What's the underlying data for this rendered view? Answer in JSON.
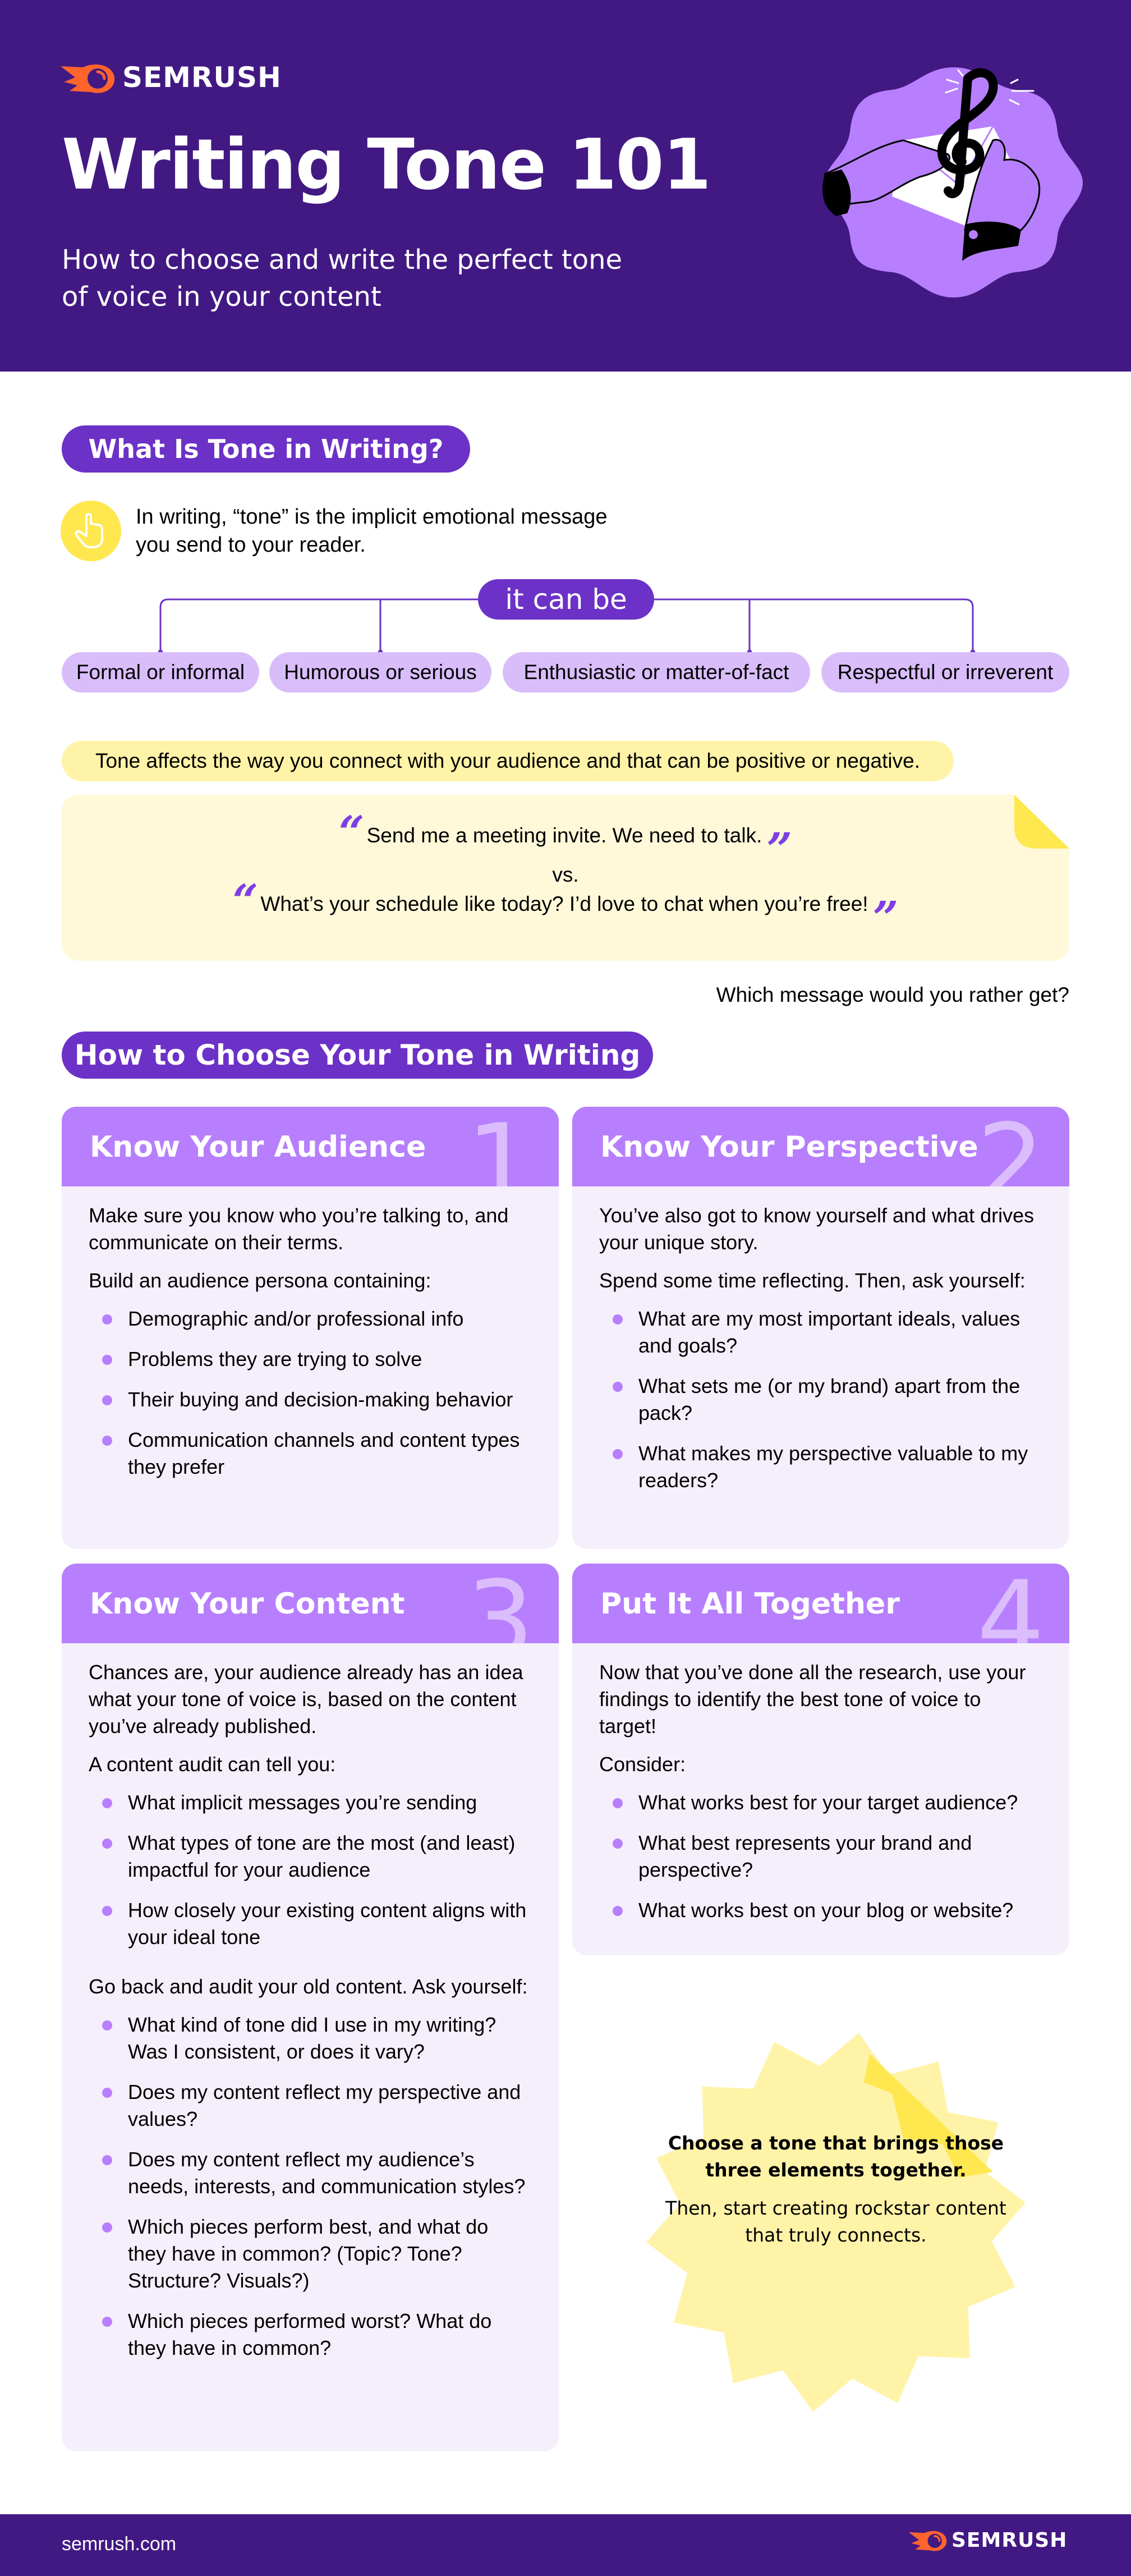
{
  "brand": {
    "name": "SEMRUSH",
    "accent": "#ff642d",
    "header_bg": "#421983",
    "purple": "#6c31c7",
    "lilac": "#b77ffd",
    "yellow": "#ffe74f"
  },
  "header": {
    "title": "Writing Tone 101",
    "subtitle": "How to choose and write the perfect tone of voice in your content",
    "illustration": "treble-clef-envelope-hands-illustration"
  },
  "section_what": {
    "heading": "What Is Tone in Writing?",
    "intro_icon": "pointing-hand-icon",
    "intro": "In writing, “tone” is the implicit emotional message you send to your reader.",
    "connector": "it can be",
    "options": [
      "Formal or informal",
      "Humorous or serious",
      "Enthusiastic or matter-of-fact",
      "Respectful or irreverent"
    ],
    "callout": "Tone affects the way you connect with your audience and that can be positive or negative.",
    "quote_1": "Send me a meeting invite. We need to talk.",
    "versus": "vs.",
    "quote_2": "What’s your schedule like today? I’d love to chat when you’re free!",
    "question": "Which message would you rather get?"
  },
  "section_how": {
    "heading": "How to Choose Your Tone in Writing",
    "cards": [
      {
        "number": "1",
        "title": "Know Your Audience",
        "paragraphs": [
          "Make sure you know who you’re talking to, and communicate on their terms.",
          "Build an audience persona containing:"
        ],
        "bullets": [
          "Demographic and/or professional info",
          "Problems they are trying to solve",
          "Their buying and decision-making behavior",
          "Communication channels and content types they prefer"
        ]
      },
      {
        "number": "2",
        "title": "Know Your Perspective",
        "paragraphs": [
          "You’ve also got to know yourself and what drives your unique story.",
          "Spend some time reflecting. Then, ask yourself:"
        ],
        "bullets": [
          "What are my most important ideals, values and goals?",
          "What sets me (or my brand) apart from the pack?",
          "What makes my perspective valuable to my readers?"
        ]
      },
      {
        "number": "3",
        "title": "Know Your Content",
        "paragraphs": [
          "Chances are, your audience already has an idea what your tone of voice is, based on the content you’ve already published.",
          "A content audit can tell you:"
        ],
        "bullets": [
          "What implicit messages you’re sending",
          "What types of tone are the most (and least) impactful for your audience",
          "How closely your existing content aligns with your ideal tone"
        ],
        "paragraphs_2": [
          "Go back and audit your old content. Ask yourself:"
        ],
        "bullets_2": [
          "What kind of tone did I use in my writing? Was I consistent, or does it vary?",
          "Does my content reflect my perspective and values?",
          "Does my content reflect my audience’s needs, interests, and communication styles?",
          "Which pieces perform best, and what do they have in common? (Topic? Tone? Structure? Visuals?)",
          "Which pieces performed worst? What do they have in common?"
        ]
      },
      {
        "number": "4",
        "title": "Put It All Together",
        "paragraphs": [
          "Now that you’ve done all the research, use your findings to identify the best tone of voice to target!",
          "Consider:"
        ],
        "bullets": [
          "What works best for your target audience?",
          "What best represents your brand and perspective?",
          "What works best on your blog or website?"
        ]
      }
    ],
    "burst_bold": "Choose a tone that brings those three elements together.",
    "burst_text": "Then, start creating rockstar content that truly connects."
  },
  "footer": {
    "url": "semrush.com",
    "logo": "SEMRUSH"
  }
}
